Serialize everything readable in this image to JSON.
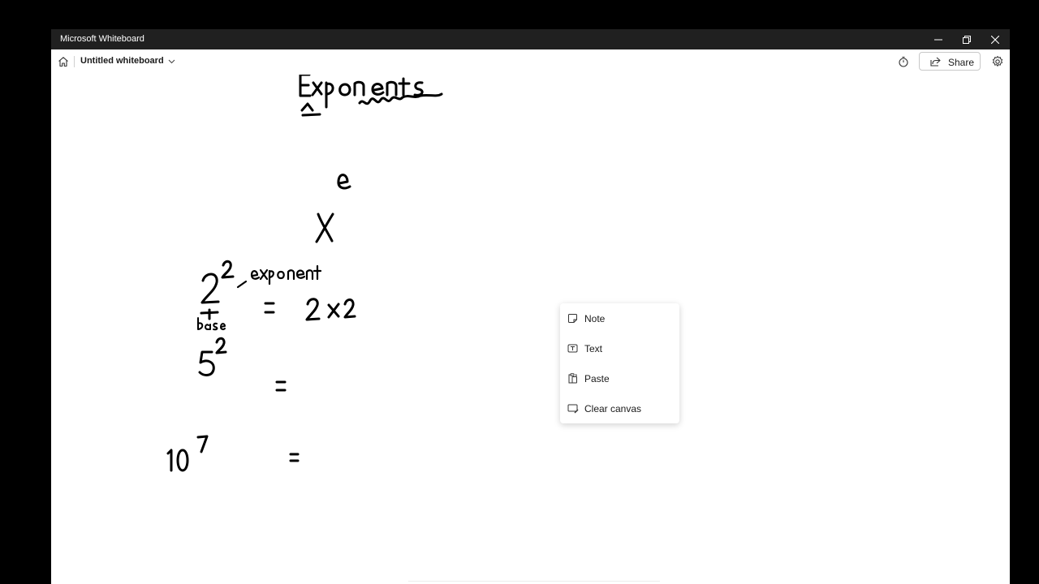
{
  "window": {
    "app_title": "Microsoft Whiteboard"
  },
  "toolbar": {
    "board_title": "Untitled whiteboard",
    "share_label": "Share"
  },
  "icons": {
    "home": "home-icon",
    "chevron": "chevron-down-icon",
    "timer": "timer-icon",
    "share": "share-icon",
    "settings": "gear-icon",
    "minimize": "minimize-icon",
    "restore": "restore-icon",
    "close": "close-icon"
  },
  "context_menu": {
    "items": [
      {
        "label": "Note",
        "icon": "note-icon"
      },
      {
        "label": "Text",
        "icon": "text-icon"
      },
      {
        "label": "Paste",
        "icon": "paste-icon"
      },
      {
        "label": "Clear canvas",
        "icon": "clear-canvas-icon"
      }
    ]
  },
  "canvas": {
    "ink_color": "#000000",
    "handwriting": {
      "heading": "Exponents",
      "expression": "x^e",
      "annotation_exponent": "exponent",
      "annotation_base": "base",
      "line1": "2^2 = 2 x 2",
      "line2": "5^2 =",
      "line3": "10^7 ="
    }
  }
}
